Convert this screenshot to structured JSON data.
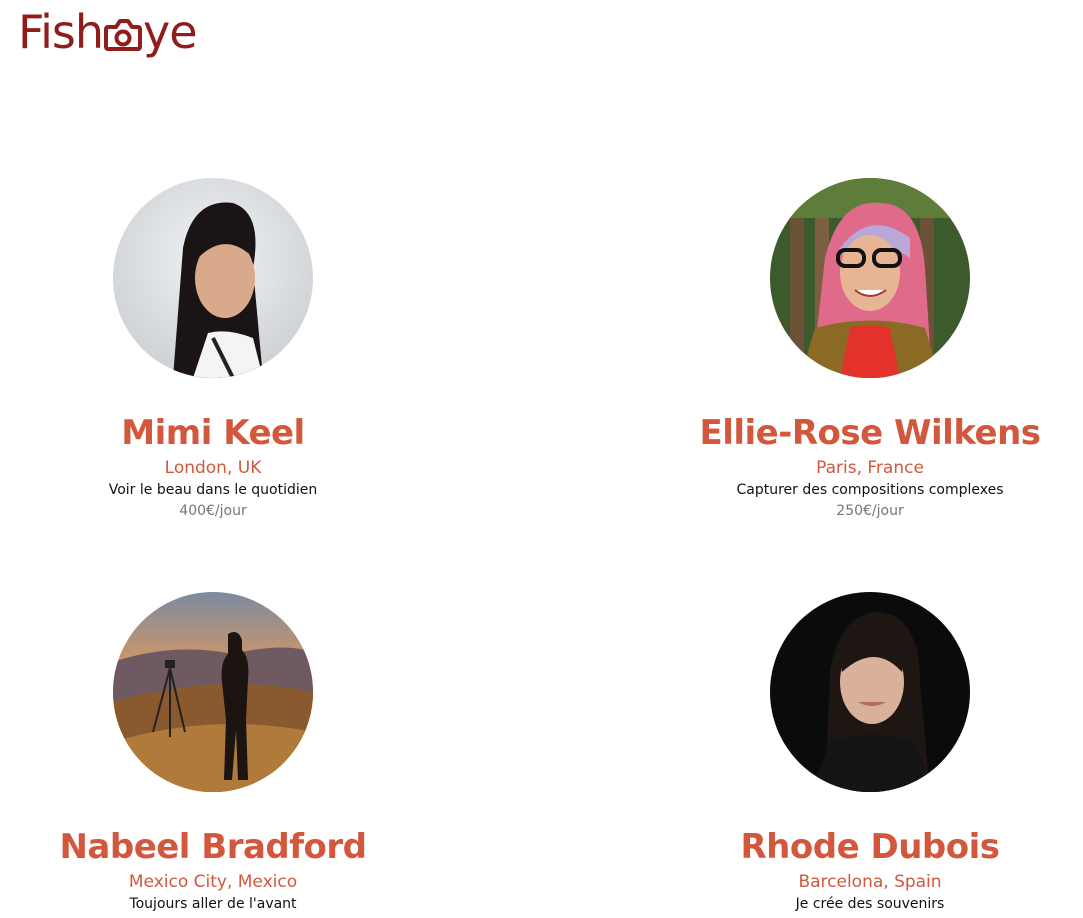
{
  "header": {
    "logo_left": "Fish",
    "logo_right": "ye",
    "logo_icon": "camera-icon"
  },
  "photographers": [
    {
      "name": "Mimi Keel",
      "location": "London, UK",
      "tagline": "Voir le beau dans le quotidien",
      "price": "400€/jour"
    },
    {
      "name": "Ellie-Rose Wilkens",
      "location": "Paris, France",
      "tagline": "Capturer des compositions complexes",
      "price": "250€/jour"
    },
    {
      "name": "Nabeel Bradford",
      "location": "Mexico City, Mexico",
      "tagline": "Toujours aller de l'avant",
      "price": ""
    },
    {
      "name": "Rhode Dubois",
      "location": "Barcelona, Spain",
      "tagline": "Je crée des souvenirs",
      "price": ""
    }
  ],
  "colors": {
    "brand": "#901c1c",
    "accent": "#d3573c",
    "price": "#757575"
  }
}
